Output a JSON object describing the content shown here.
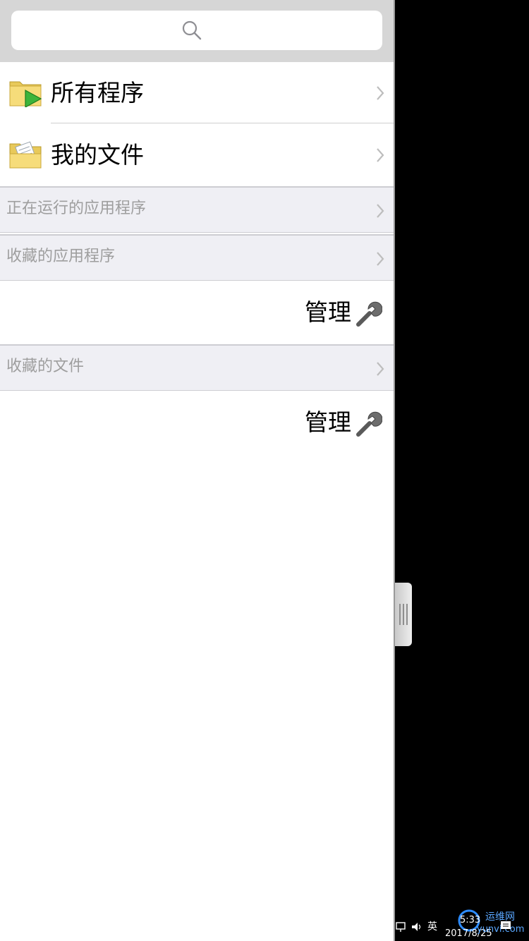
{
  "search": {
    "icon": "search-icon"
  },
  "menu": {
    "all_programs": {
      "label": "所有程序",
      "icon": "folder-play-icon"
    },
    "my_files": {
      "label": "我的文件",
      "icon": "folder-documents-icon"
    }
  },
  "sections": {
    "running_apps": {
      "label": "正在运行的应用程序"
    },
    "favorite_apps": {
      "label": "收藏的应用程序",
      "manage_label": "管理"
    },
    "favorite_files": {
      "label": "收藏的文件",
      "manage_label": "管理"
    }
  },
  "taskbar": {
    "ime": "英",
    "time": "5:33",
    "date": "2017/8/25"
  },
  "watermark": {
    "line1": "运维网",
    "line2": "yunvi.com"
  }
}
